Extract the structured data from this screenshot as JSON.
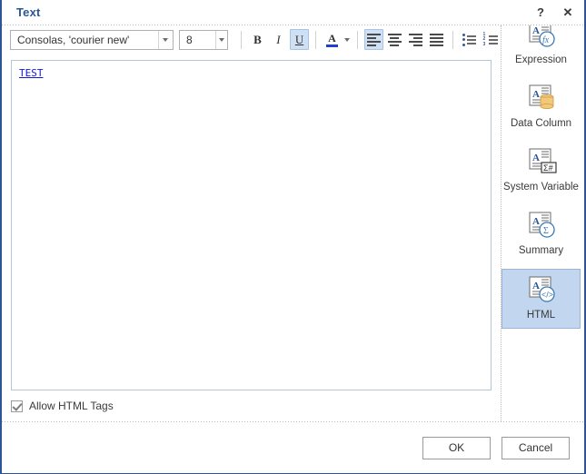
{
  "window": {
    "title": "Text",
    "help_icon": "?",
    "close_icon": "✕"
  },
  "toolbar": {
    "font_family_value": "Consolas, 'courier new'",
    "font_size_value": "8",
    "bold_label": "B",
    "italic_label": "I",
    "underline_label": "U",
    "font_color_label": "A",
    "font_color_hex": "#1f3fd0",
    "align_left": "align-left",
    "align_center": "align-center",
    "align_right": "align-right",
    "align_justify": "align-justify",
    "bullet_list": "bulleted-list",
    "numbered_list": "numbered-list",
    "active_buttons": [
      "underline",
      "align-left"
    ]
  },
  "editor": {
    "content": "TEST",
    "content_color": "#1414e0"
  },
  "options": {
    "allow_html_tags_label": "Allow HTML Tags",
    "allow_html_tags_checked": true
  },
  "element_panel": {
    "items": [
      {
        "label": "Expression",
        "icon": "expression-icon",
        "selected": false
      },
      {
        "label": "Data Column",
        "icon": "data-column-icon",
        "selected": false
      },
      {
        "label": "System Variable",
        "icon": "system-variable-icon",
        "selected": false
      },
      {
        "label": "Summary",
        "icon": "summary-icon",
        "selected": false
      },
      {
        "label": "HTML",
        "icon": "html-icon",
        "selected": true
      }
    ],
    "selected_highlight_hex": "#c2d6ef"
  },
  "footer": {
    "ok_label": "OK",
    "cancel_label": "Cancel"
  },
  "colors": {
    "title_blue": "#2a5699",
    "frame_blue": "#2a5699",
    "toolbar_active": "#cfe0f5"
  }
}
